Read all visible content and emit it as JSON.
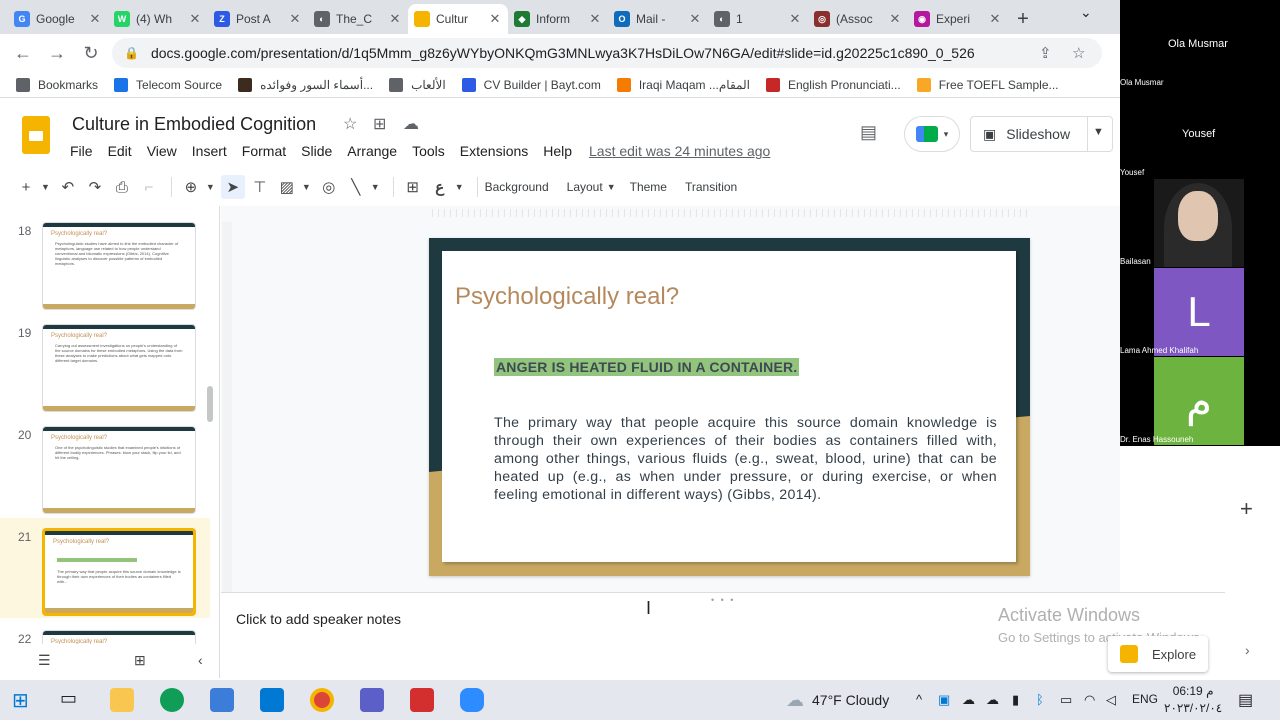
{
  "browser": {
    "tabs": [
      {
        "label": "Google",
        "color": "#4285f4",
        "glyph": "G"
      },
      {
        "label": "(4) Wh",
        "color": "#25d366",
        "glyph": "W"
      },
      {
        "label": "Post A",
        "color": "#2d5be3",
        "glyph": "Z"
      },
      {
        "label": "The_C",
        "color": "#5f6368",
        "glyph": "◐"
      },
      {
        "label": "Cultur",
        "color": "#f4b400",
        "glyph": ""
      },
      {
        "label": "Inform",
        "color": "#1e7b34",
        "glyph": "◆"
      },
      {
        "label": "Mail -",
        "color": "#0f6cbd",
        "glyph": "O"
      },
      {
        "label": "1",
        "color": "#5f6368",
        "glyph": "◐"
      },
      {
        "label": "(Assoc",
        "color": "#8b2e2e",
        "glyph": "◎"
      },
      {
        "label": "Experi",
        "color": "#b5179e",
        "glyph": "◉"
      }
    ],
    "active_tab_index": 4,
    "url": "docs.google.com/presentation/d/1q5Mmm_g8z6yWYbyONKQmG3MNLwya3K7HsDiLOw7N6GA/edit#slide=id.g20225c1c890_0_526",
    "bookmarks": [
      {
        "label": "Bookmarks",
        "color": "#5f6368"
      },
      {
        "label": "Telecom Source",
        "color": "#1a73e8"
      },
      {
        "label": "أسماء السور وفوائده...",
        "color": "#3d2b1f"
      },
      {
        "label": "الألعاب",
        "color": "#5f6368"
      },
      {
        "label": "CV Builder | Bayt.com",
        "color": "#2d5be3"
      },
      {
        "label": "Iraqi Maqam ...المقام",
        "color": "#f57c00"
      },
      {
        "label": "English Pronunciati...",
        "color": "#c62828"
      },
      {
        "label": "Free TOEFL Sample...",
        "color": "#f9a825"
      }
    ]
  },
  "app": {
    "doc_title": "Culture in Embodied Cognition",
    "menus": [
      "File",
      "Edit",
      "View",
      "Insert",
      "Format",
      "Slide",
      "Arrange",
      "Tools",
      "Extensions",
      "Help"
    ],
    "last_edit": "Last edit was 24 minutes ago",
    "slideshow_label": "Slideshow"
  },
  "toolbar": {
    "background_label": "Background",
    "layout_label": "Layout",
    "theme_label": "Theme",
    "transition_label": "Transition"
  },
  "filmstrip": {
    "slides": [
      {
        "num": "18",
        "title": "Psychologically real?",
        "body": "Psycholinguistic studies have aimed to link the embodied character of metaphors, language use related to how people understand conventional and idiomatic expressions (Gibbs, 2014). Cognitive linguistic analyses to discover possible patterns of embodied metaphors."
      },
      {
        "num": "19",
        "title": "Psychologically real?",
        "body": "Carrying out assessment investigations on people's understanding of the source domains for these embodied metaphors. Using the data from these analyses to make predictions about what gets mapped onto different target domains."
      },
      {
        "num": "20",
        "title": "Psychologically real?",
        "body": "One of the psycholinguistic studies that examined people's intuitions of different bodily experiences. Phrases: blow your stack, flip your lid, and hit the ceiling."
      },
      {
        "num": "21",
        "title": "Psychologically real?",
        "body": "The primary way that people acquire this source domain knowledge is through their own experiences of their bodies as containers filled with..."
      },
      {
        "num": "22",
        "title": "Psychologically real?",
        "body": ""
      }
    ],
    "active_index": 3
  },
  "slide": {
    "title": "Psychologically real?",
    "metaphor": "ANGER IS HEATED FLUID IN A CONTAINER.",
    "body": "The primary way that people acquire this source domain knowledge is through their own experiences of their bodies as containers filled with, among other things, various fluids (e.g., sweat, blood, urine) that can be heated up (e.g., as when under pressure, or during exercise, or when feeling emotional in different ways) (Gibbs, 2014)."
  },
  "speaker_notes_placeholder": "Click to add speaker notes",
  "explore_label": "Explore",
  "activate_windows": {
    "line1": "Activate Windows",
    "line2": "Go to Settings to activate Windows."
  },
  "video_call": {
    "participants": [
      {
        "name": "Ola Musmar",
        "tile_name": "Ola Musmar"
      },
      {
        "name": "Yousef",
        "tile_name": "Yousef"
      },
      {
        "name": "Bailasan",
        "initial": ""
      },
      {
        "name": "Lama Ahmed Khalifah",
        "initial": "L"
      },
      {
        "name": "Dr. Enas Hassouneh",
        "initial": "م"
      }
    ]
  },
  "taskbar": {
    "weather": "47°F Cloudy",
    "language": "ENG",
    "time": "06:19 م",
    "date": "٢٠٢٣/٠٢/٠٤"
  }
}
